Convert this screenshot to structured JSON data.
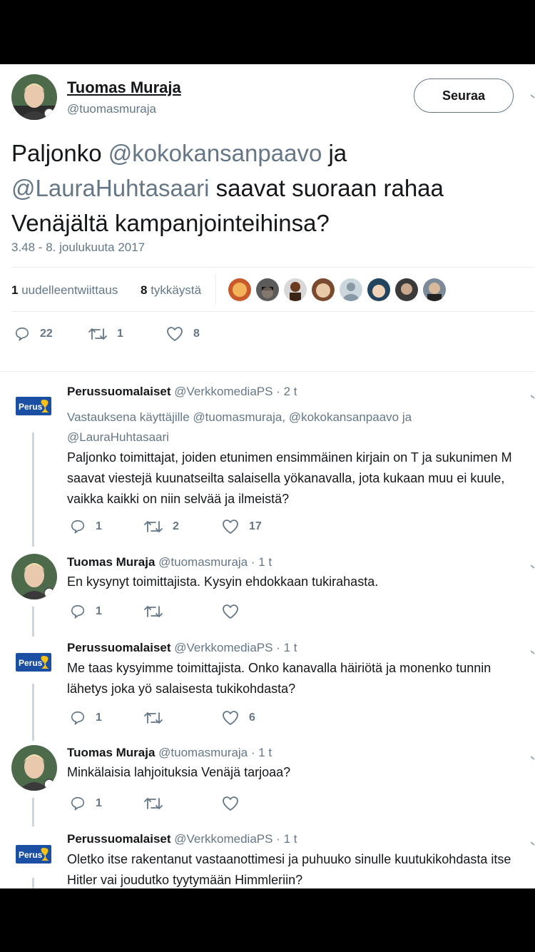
{
  "main_tweet": {
    "author_name": "Tuomas Muraja",
    "author_handle": "@tuomasmuraja",
    "follow_label": "Seuraa",
    "text_parts": {
      "p1": "Paljonko ",
      "mention1": "@kokokansanpaavo",
      "p2": " ja",
      "mention2": "@LauraHuhtasaari",
      "p3": " saavat suoraan rahaa",
      "p4": "Venäjältä kampanjointeihinsa?"
    },
    "timestamp": "3.48 - 8. joulukuuta 2017",
    "retweets_count": "1",
    "retweets_label": "uudelleentwiittaus",
    "likes_count": "8",
    "likes_label": "tykkäystä",
    "actions": {
      "replies": "22",
      "retweets": "1",
      "likes": "8"
    }
  },
  "replies": [
    {
      "name": "Perussuomalaiset",
      "handle": "@VerkkomediaPS",
      "time": "· 2 t",
      "reply_to_line1": "Vastauksena käyttäjille @tuomasmuraja, @kokokansanpaavo ja",
      "reply_to_line2": "@LauraHuhtasaari",
      "line1": "Paljonko toimittajat, joiden etunimen ensimmäinen kirjain on T ja sukunimen M",
      "line2": "saavat viestejä kuunatseilta salaisella yökanavalla, jota kukaan muu ei kuule,",
      "line3": "vaikka kaikki on niin selvää ja ilmeistä?",
      "replies": "1",
      "retweets": "2",
      "likes": "17"
    },
    {
      "name": "Tuomas Muraja",
      "handle": "@tuomasmuraja",
      "time": "· 1 t",
      "line1": "En kysynyt toimittajista. Kysyin ehdokkaan tukirahasta.",
      "replies": "1",
      "retweets": "",
      "likes": ""
    },
    {
      "name": "Perussuomalaiset",
      "handle": "@VerkkomediaPS",
      "time": "· 1 t",
      "line1": "Me taas kysyimme toimittajista. Onko kanavalla häiriötä ja monenko tunnin",
      "line2": "lähetys joka yö salaisesta tukikohdasta?",
      "replies": "1",
      "retweets": "",
      "likes": "6"
    },
    {
      "name": "Tuomas Muraja",
      "handle": "@tuomasmuraja",
      "time": "· 1 t",
      "line1": "Minkälaisia lahjoituksia Venäjä tarjoaa?",
      "replies": "1",
      "retweets": "",
      "likes": ""
    },
    {
      "name": "Perussuomalaiset",
      "handle": "@VerkkomediaPS",
      "time": "· 1 t",
      "line1": "Oletko itse rakentanut vastaanottimesi ja puhuuko sinulle kuutukikohdasta itse",
      "line2": "Hitler vai joudutko tyytymään Himmleriin?"
    }
  ],
  "logo_text": "Perus",
  "colors": {
    "background": "#ffffff",
    "text": "#14171a",
    "muted": "#657786",
    "border": "#e6ecf0",
    "ps_blue": "#1b4fa3",
    "ps_yellow": "#f4c21a"
  }
}
